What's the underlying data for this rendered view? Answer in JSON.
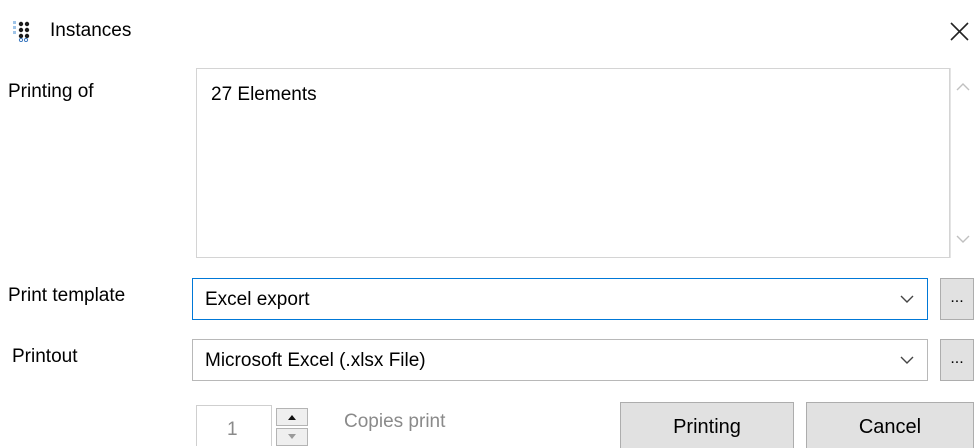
{
  "window": {
    "title": "Instances",
    "app_icon": "instances-icon",
    "close_icon": "close-icon"
  },
  "printing_of": {
    "label": "Printing of",
    "content": "27 Elements"
  },
  "print_template": {
    "label": "Print template",
    "value": "Excel export",
    "browse_label": "..."
  },
  "printout": {
    "label": "Printout",
    "value": "Microsoft Excel (.xlsx File)",
    "browse_label": "..."
  },
  "copies": {
    "value": "1",
    "label": "Copies print"
  },
  "buttons": {
    "printing": "Printing",
    "cancel": "Cancel"
  },
  "colors": {
    "focus_border": "#0078d7",
    "button_bg": "#e1e1e1",
    "disabled_text": "#8a8a8a"
  }
}
